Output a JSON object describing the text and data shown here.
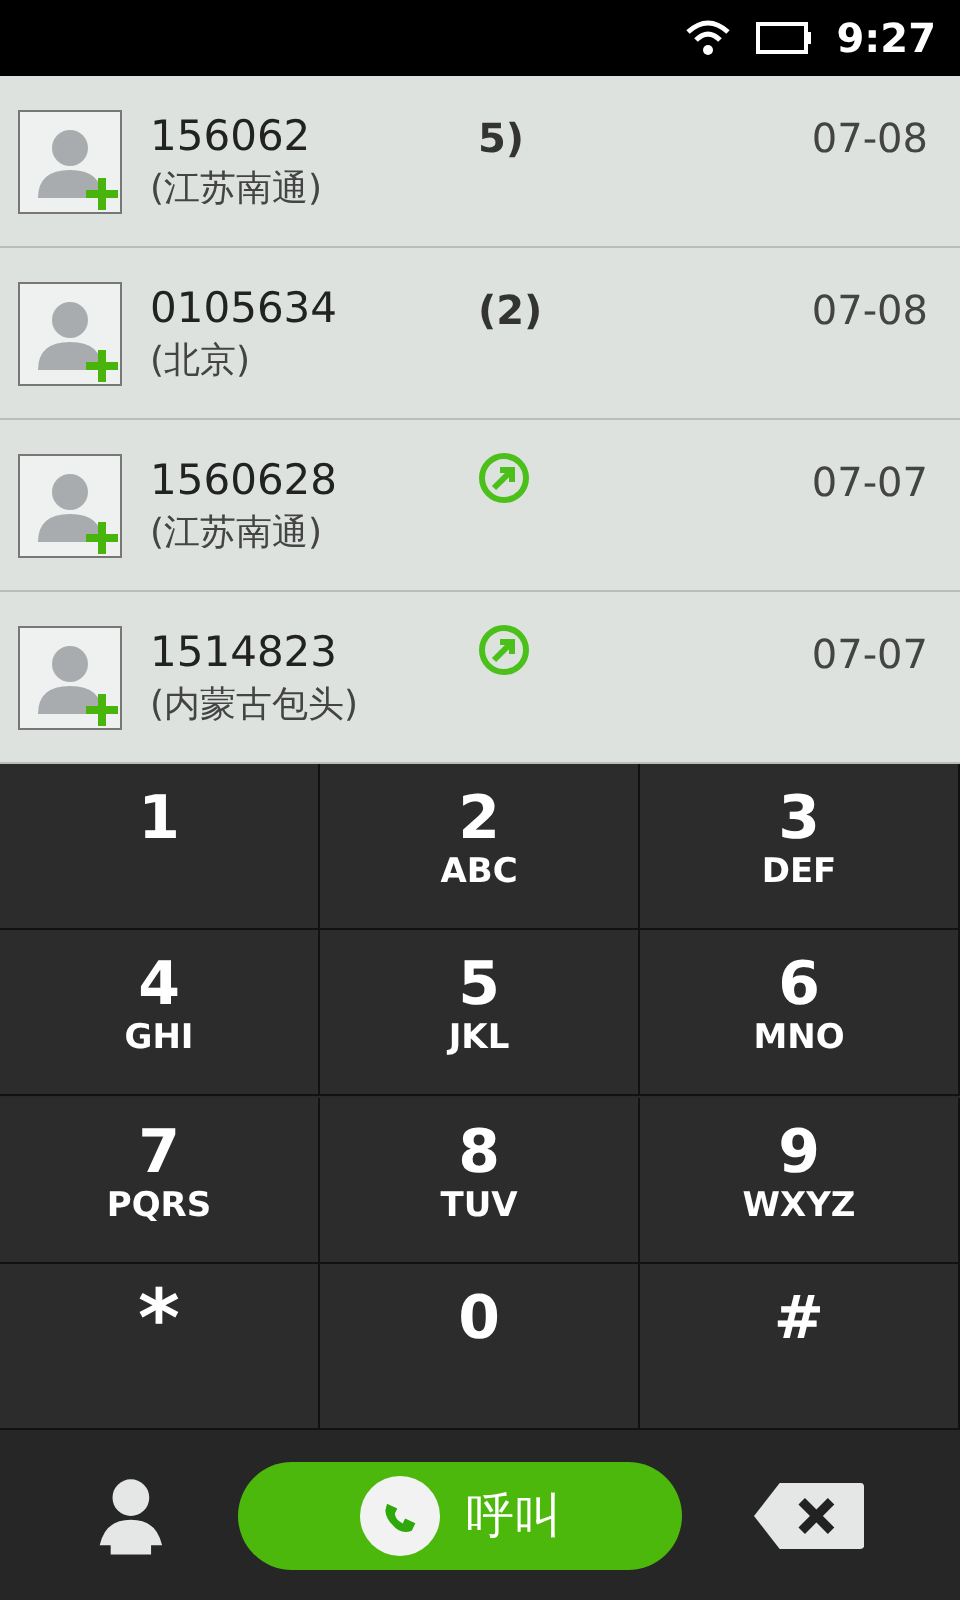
{
  "status_bar": {
    "time": "9:27"
  },
  "call_log": [
    {
      "number": "156062",
      "location": "(江苏南通)",
      "date": "07-08",
      "kind": "count",
      "count": "5)"
    },
    {
      "number": "0105634",
      "location": "(北京)",
      "date": "07-08",
      "kind": "count",
      "count": "(2)"
    },
    {
      "number": "1560628",
      "location": "(江苏南通)",
      "date": "07-07",
      "kind": "outgoing"
    },
    {
      "number": "1514823",
      "location": "(内蒙古包头)",
      "date": "07-07",
      "kind": "outgoing"
    }
  ],
  "keypad": [
    {
      "digit": "1"
    },
    {
      "digit": "2",
      "letters": "ABC"
    },
    {
      "digit": "3",
      "letters": "DEF"
    },
    {
      "digit": "4",
      "letters": "GHI"
    },
    {
      "digit": "5",
      "letters": "JKL"
    },
    {
      "digit": "6",
      "letters": "MNO"
    },
    {
      "digit": "7",
      "letters": "PQRS"
    },
    {
      "digit": "8",
      "letters": "TUV"
    },
    {
      "digit": "9",
      "letters": "WXYZ"
    },
    {
      "digit": "*"
    },
    {
      "digit": "0"
    },
    {
      "digit": "#"
    }
  ],
  "call_button": {
    "label": "呼叫"
  }
}
